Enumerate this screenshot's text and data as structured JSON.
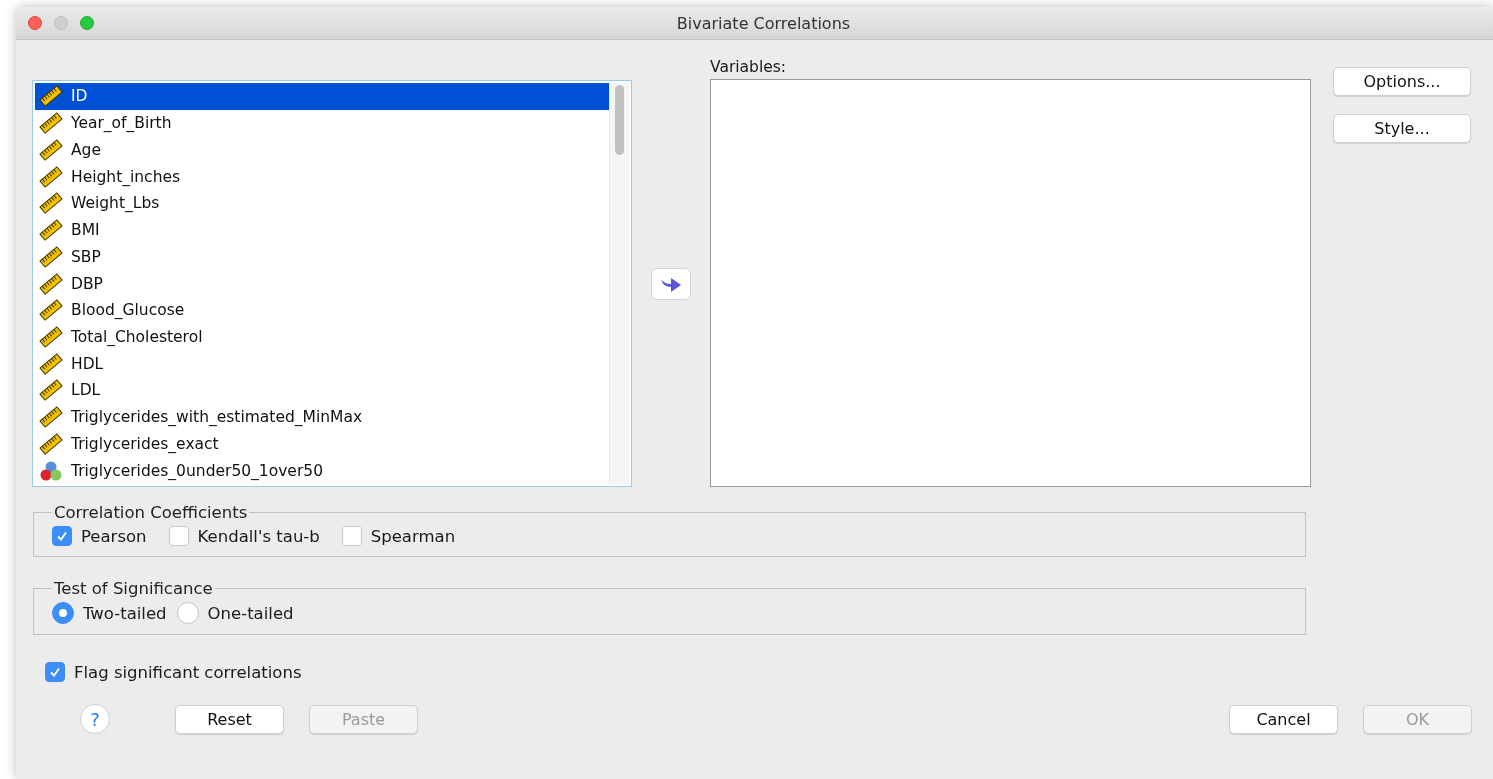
{
  "window": {
    "title": "Bivariate Correlations"
  },
  "source_list": {
    "items": [
      {
        "label": "ID",
        "kind": "scale",
        "selected": true
      },
      {
        "label": "Year_of_Birth",
        "kind": "scale",
        "selected": false
      },
      {
        "label": "Age",
        "kind": "scale",
        "selected": false
      },
      {
        "label": "Height_inches",
        "kind": "scale",
        "selected": false
      },
      {
        "label": "Weight_Lbs",
        "kind": "scale",
        "selected": false
      },
      {
        "label": "BMI",
        "kind": "scale",
        "selected": false
      },
      {
        "label": "SBP",
        "kind": "scale",
        "selected": false
      },
      {
        "label": "DBP",
        "kind": "scale",
        "selected": false
      },
      {
        "label": "Blood_Glucose",
        "kind": "scale",
        "selected": false
      },
      {
        "label": "Total_Cholesterol",
        "kind": "scale",
        "selected": false
      },
      {
        "label": "HDL",
        "kind": "scale",
        "selected": false
      },
      {
        "label": "LDL",
        "kind": "scale",
        "selected": false
      },
      {
        "label": "Triglycerides_with_estimated_MinMax",
        "kind": "scale",
        "selected": false
      },
      {
        "label": "Triglycerides_exact",
        "kind": "scale",
        "selected": false
      },
      {
        "label": "Triglycerides_0under50_1over50",
        "kind": "nominal",
        "selected": false
      }
    ]
  },
  "target_list": {
    "label": "Variables:"
  },
  "side_buttons": [
    "Options...",
    "Style..."
  ],
  "coefficients": {
    "title": "Correlation Coefficients",
    "options": [
      {
        "label": "Pearson",
        "checked": true
      },
      {
        "label": "Kendall's tau-b",
        "checked": false
      },
      {
        "label": "Spearman",
        "checked": false
      }
    ]
  },
  "significance": {
    "title": "Test of Significance",
    "options": [
      {
        "label": "Two-tailed",
        "selected": true
      },
      {
        "label": "One-tailed",
        "selected": false
      }
    ]
  },
  "flag": {
    "label": "Flag significant correlations",
    "checked": true
  },
  "footer": {
    "help": "?",
    "left_buttons": [
      {
        "label": "Reset",
        "disabled": false
      },
      {
        "label": "Paste",
        "disabled": true
      }
    ],
    "right_buttons": [
      {
        "label": "Cancel",
        "disabled": false
      },
      {
        "label": "OK",
        "disabled": true
      }
    ]
  }
}
